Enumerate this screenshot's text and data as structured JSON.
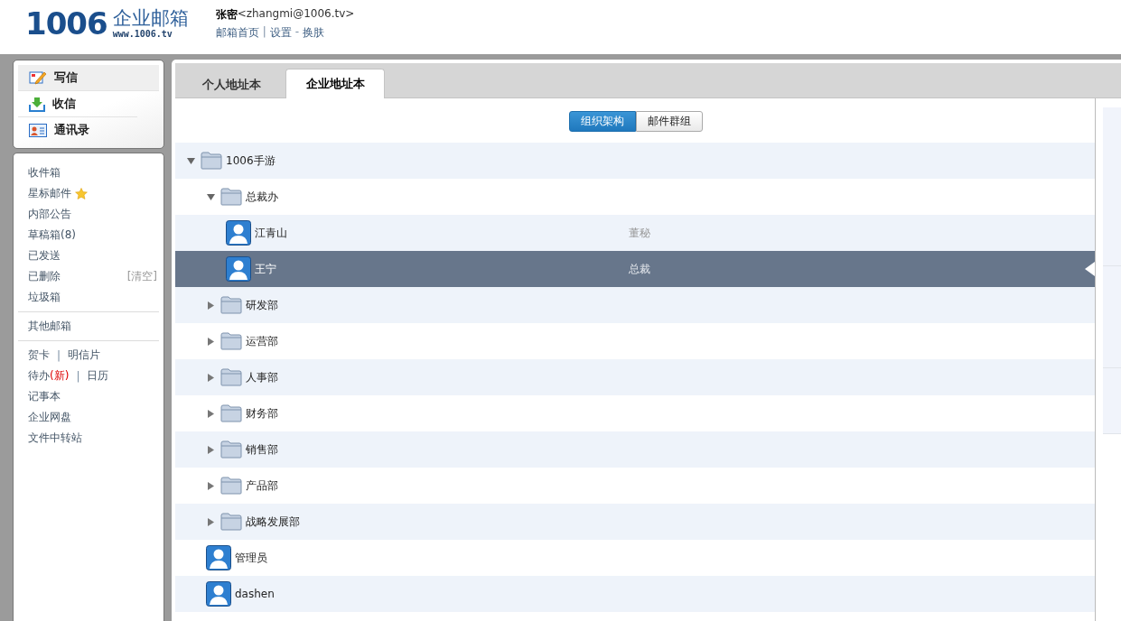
{
  "logo": {
    "mark": "1006",
    "name": "企业邮箱",
    "url": "www.1006.tv"
  },
  "user": {
    "name": "张密",
    "email": "<zhangmi@1006.tv>",
    "links": [
      {
        "label": "邮箱首页",
        "sep": "|"
      },
      {
        "label": "设置",
        "sep": "-"
      },
      {
        "label": "换肤"
      }
    ]
  },
  "sidebar": {
    "actions": [
      {
        "kind": "write",
        "label": "写信",
        "selected": true
      },
      {
        "kind": "receive",
        "label": "收信",
        "selected": false
      },
      {
        "kind": "contacts",
        "label": "通讯录",
        "selected": false
      }
    ],
    "folders": [
      {
        "label": "收件箱",
        "starred": false
      },
      {
        "label": "星标邮件",
        "starred": true
      },
      {
        "label": "内部公告",
        "starred": false
      },
      {
        "label": "草稿箱(8)",
        "starred": false
      },
      {
        "label": "已发送",
        "starred": false
      },
      {
        "label": "已删除",
        "starred": false,
        "action": "[清空]"
      },
      {
        "label": "垃圾箱",
        "starred": false
      }
    ],
    "other": "其他邮箱",
    "tools": [
      [
        {
          "label": "贺卡"
        },
        {
          "label": "明信片",
          "sep": "|"
        }
      ],
      [
        {
          "label": "待办",
          "badge": "(新)"
        },
        {
          "label": "日历",
          "sep": "|"
        }
      ],
      [
        {
          "label": "记事本"
        }
      ],
      [
        {
          "label": "企业网盘"
        }
      ],
      [
        {
          "label": "文件中转站"
        }
      ]
    ]
  },
  "tabs": [
    {
      "label": "个人地址本",
      "selected": false
    },
    {
      "label": "企业地址本",
      "selected": true
    }
  ],
  "view_toggle": [
    {
      "label": "组织架构",
      "selected": true
    },
    {
      "label": "邮件群组",
      "selected": false
    }
  ],
  "tree": [
    {
      "kind": "dept",
      "name": "1006手游",
      "expanded": true,
      "selected": false,
      "children": [
        {
          "kind": "dept",
          "name": "总裁办",
          "expanded": true,
          "selected": false,
          "children": [
            {
              "kind": "person",
              "name": "江青山",
              "title": "董秘",
              "selected": false
            },
            {
              "kind": "person",
              "name": "王宁",
              "title": "总裁",
              "selected": true
            }
          ]
        },
        {
          "kind": "dept",
          "name": "研发部",
          "expanded": false,
          "selected": false
        },
        {
          "kind": "dept",
          "name": "运营部",
          "expanded": false,
          "selected": false
        },
        {
          "kind": "dept",
          "name": "人事部",
          "expanded": false,
          "selected": false
        },
        {
          "kind": "dept",
          "name": "财务部",
          "expanded": false,
          "selected": false
        },
        {
          "kind": "dept",
          "name": "销售部",
          "expanded": false,
          "selected": false
        },
        {
          "kind": "dept",
          "name": "产品部",
          "expanded": false,
          "selected": false
        },
        {
          "kind": "dept",
          "name": "战略发展部",
          "expanded": false,
          "selected": false
        },
        {
          "kind": "person",
          "name": "管理员",
          "selected": false
        },
        {
          "kind": "person",
          "name": "dashen",
          "selected": false
        }
      ]
    }
  ]
}
